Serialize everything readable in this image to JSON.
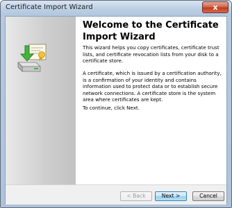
{
  "window": {
    "title": "Certificate Import Wizard",
    "close_label": "x"
  },
  "sidebar": {
    "icon": "certificate-wizard-icon"
  },
  "main": {
    "heading": "Welcome to the Certificate Import Wizard",
    "paragraphs": [
      "This wizard helps you copy certificates, certificate trust lists, and certificate revocation lists from your disk to a certificate store.",
      "A certificate, which is issued by a certification authority, is a confirmation of your identity and contains information used to protect data or to establish secure network connections. A certificate store is the system area where certificates are kept.",
      "To continue, click Next."
    ]
  },
  "buttons": {
    "back": "< Back",
    "next": "Next >",
    "cancel": "Cancel"
  },
  "colors": {
    "title_bar": "#bccfe4",
    "close_button": "#c03b1d",
    "next_button": "#98d1ef"
  }
}
